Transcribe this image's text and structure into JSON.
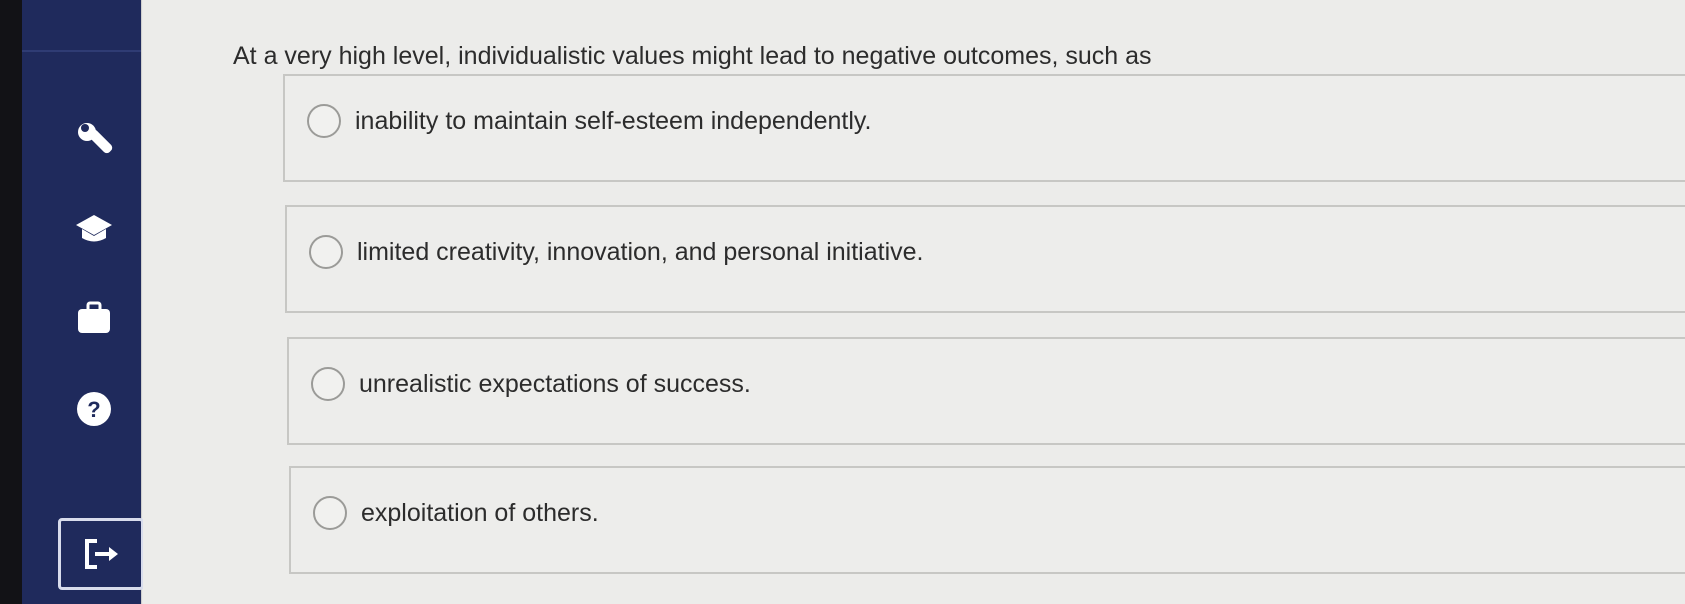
{
  "sidebar": {
    "icons": [
      {
        "name": "wrench-icon"
      },
      {
        "name": "graduation-cap-icon"
      },
      {
        "name": "briefcase-icon"
      },
      {
        "name": "help-icon",
        "glyph": "?"
      },
      {
        "name": "exit-icon"
      }
    ],
    "colors": {
      "background": "#1f2a5c",
      "icon": "#ffffff"
    }
  },
  "question": {
    "text": "At a very high level, individualistic values might lead to negative outcomes, such as",
    "options": [
      {
        "label": "inability to maintain self-esteem independently.",
        "selected": false
      },
      {
        "label": "limited creativity, innovation, and personal initiative.",
        "selected": false
      },
      {
        "label": "unrealistic expectations of success.",
        "selected": false
      },
      {
        "label": "exploitation of others.",
        "selected": false
      }
    ]
  }
}
